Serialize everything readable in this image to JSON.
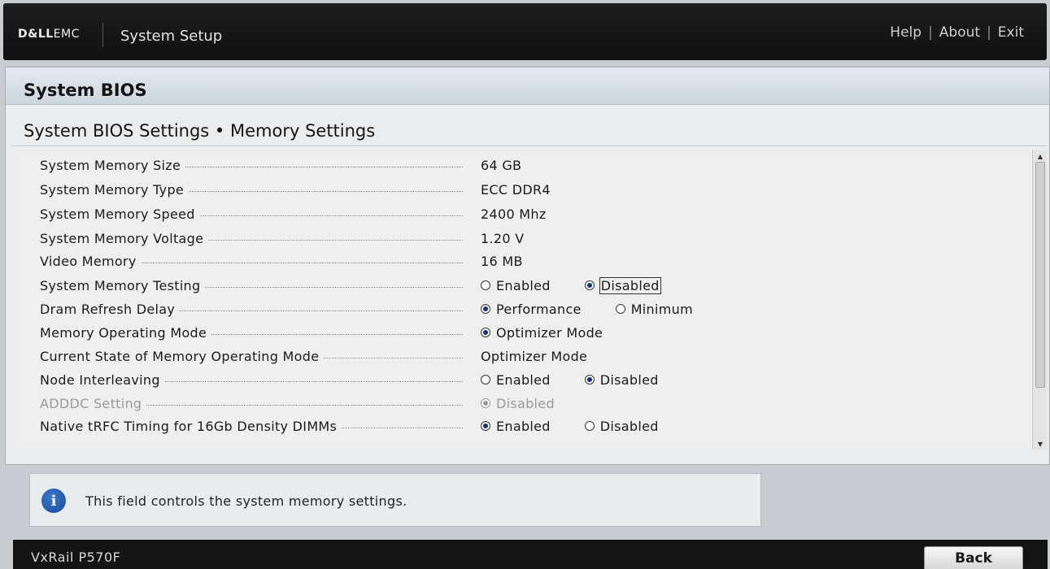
{
  "header": {
    "logo_dell": "D&LL",
    "logo_emc": "EMC",
    "app_title": "System Setup",
    "links": [
      "Help",
      "About",
      "Exit"
    ],
    "separator": "|"
  },
  "page": {
    "title": "System BIOS",
    "section": "System BIOS Settings • Memory Settings"
  },
  "settings": [
    {
      "label": "System Memory Size",
      "value": "64 GB"
    },
    {
      "label": "System Memory Type",
      "value": "ECC DDR4"
    },
    {
      "label": "System Memory Speed",
      "value": "2400 Mhz"
    },
    {
      "label": "System Memory Voltage",
      "value": "1.20 V"
    },
    {
      "label": "Video Memory",
      "value": "16 MB"
    },
    {
      "label": "System Memory Testing",
      "options": [
        {
          "label": "Enabled",
          "selected": false
        },
        {
          "label": "Disabled",
          "selected": true,
          "focused": true
        }
      ]
    },
    {
      "label": "Dram Refresh Delay",
      "options": [
        {
          "label": "Performance",
          "selected": true
        },
        {
          "label": "Minimum",
          "selected": false
        }
      ]
    },
    {
      "label": "Memory Operating Mode",
      "options": [
        {
          "label": "Optimizer Mode",
          "selected": true
        }
      ]
    },
    {
      "label": "Current State of Memory Operating Mode",
      "value": "Optimizer Mode"
    },
    {
      "label": "Node Interleaving",
      "options": [
        {
          "label": "Enabled",
          "selected": false
        },
        {
          "label": "Disabled",
          "selected": true
        }
      ]
    },
    {
      "label": "ADDDC Setting",
      "disabled": true,
      "options": [
        {
          "label": "Disabled",
          "selected": true
        }
      ]
    },
    {
      "label": "Native tRFC Timing for 16Gb Density DIMMs",
      "options": [
        {
          "label": "Enabled",
          "selected": true
        },
        {
          "label": "Disabled",
          "selected": false
        }
      ]
    }
  ],
  "help": {
    "icon": "info-icon",
    "text": "This field controls the system memory settings."
  },
  "footer": {
    "model": "VxRail P570F",
    "back_label": "Back"
  }
}
